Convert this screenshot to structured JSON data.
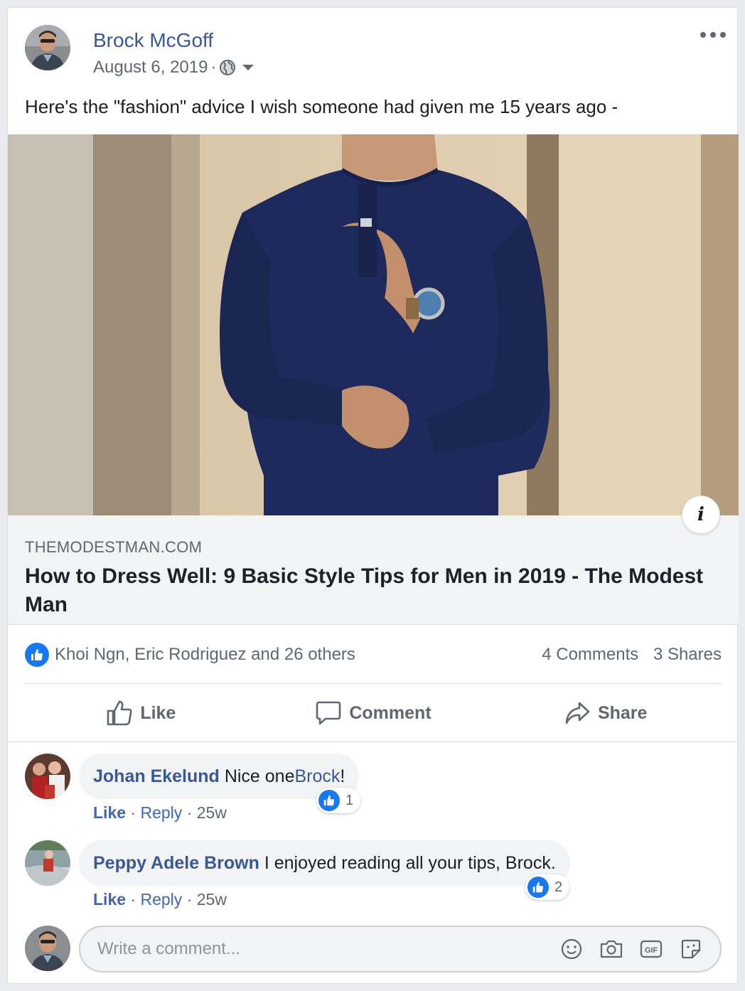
{
  "post": {
    "author": "Brock McGoff",
    "date": "August 6, 2019",
    "separator": "·",
    "audience_icon": "globe-icon",
    "text": "Here's the \"fashion\" advice I wish someone had given me 15 years ago -"
  },
  "link_preview": {
    "domain": "THEMODESTMAN.COM",
    "title": "How to Dress Well: 9 Basic Style Tips for Men in 2019 - The Modest Man",
    "info_label": "i"
  },
  "stats": {
    "reactions_text": "Khoi Ngn, Eric Rodriguez and 26 others",
    "comments": "4 Comments",
    "shares": "3 Shares"
  },
  "actions": {
    "like": "Like",
    "comment": "Comment",
    "share": "Share"
  },
  "comments": [
    {
      "name": "Johan Ekelund",
      "text": "Nice one ",
      "mention": "Brock",
      "trailing": "!",
      "reactions": "1",
      "like": "Like",
      "reply": "Reply",
      "time": "25w"
    },
    {
      "name": "Peppy Adele Brown",
      "text": "I enjoyed reading all your tips, Brock.",
      "reactions": "2",
      "like": "Like",
      "reply": "Reply",
      "time": "25w"
    }
  ],
  "composer": {
    "placeholder": "Write a comment...",
    "icons": [
      "emoji-icon",
      "camera-icon",
      "gif-icon",
      "sticker-icon"
    ]
  },
  "colors": {
    "link_blue": "#385898",
    "like_blue": "#1877f2",
    "shirt_navy": "#1f2a5c"
  }
}
